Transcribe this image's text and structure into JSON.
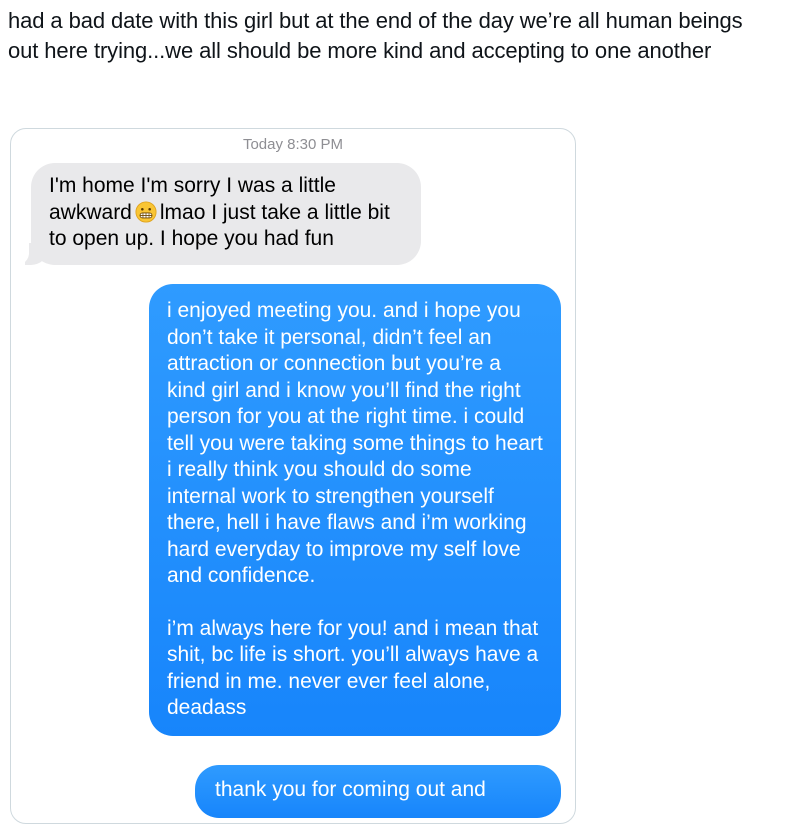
{
  "tweet": {
    "text": "had a bad date with this girl but at the end of the day we’re all human beings out here trying...we all should be more kind and accepting to one another"
  },
  "messages": {
    "timestamp": "Today 8:30 PM",
    "received": {
      "before_emoji": "I'm home I'm sorry I was a little awkward",
      "emoji": "grimacing-face-icon",
      "after_emoji": "lmao I just take a little bit to open up. I hope you had fun"
    },
    "sent_1": {
      "paragraph_1": "i enjoyed meeting you. and i hope you don’t take it personal, didn’t feel an attraction or connection but you’re a kind girl and i know you’ll find the right person for you at the right time. i could tell you were taking some things to heart i really think you should do some internal work to strengthen yourself there, hell i have flaws and i’m working hard everyday to improve my self love and confidence.",
      "paragraph_2": "i’m always here for you! and i mean that shit, bc life is short. you’ll always have a friend in me. never ever feel alone, deadass"
    },
    "sent_2": {
      "text": "thank you for coming out and"
    }
  },
  "colors": {
    "received_bubble": "#e9e9eb",
    "sent_bubble": "#1a8cff",
    "timestamp": "#8e8e93"
  }
}
